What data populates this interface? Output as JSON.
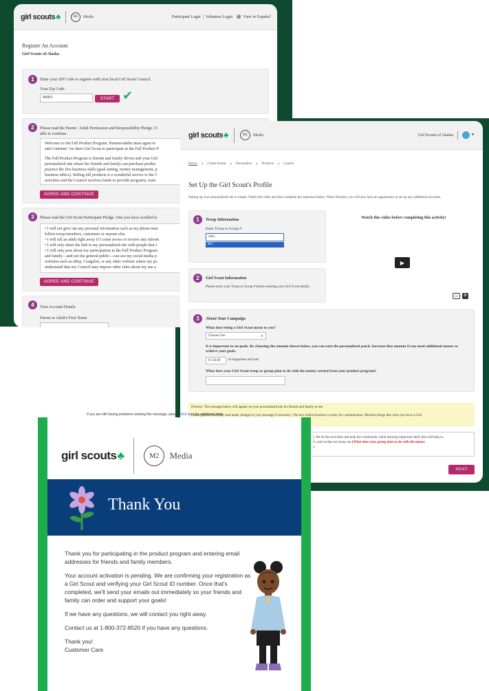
{
  "brand": {
    "gs": "girl scouts",
    "m2": "M2",
    "media": "Media"
  },
  "win1": {
    "nav": {
      "participant": "Participant Login",
      "volunteer": "Volunteer Login",
      "espanol": "View in Español"
    },
    "title": "Register An Account",
    "council": "Girl Scouts of Alaska",
    "step1": {
      "num": "1",
      "text": "Enter your ZIP Code to register with your local Girl Scout Council.",
      "label": "Your Zip Code",
      "value": "00001",
      "button": "START"
    },
    "step2": {
      "num": "2",
      "text": "Please read the Parent / Adult Permission and Responsibility Pledge. O",
      "text2": "able to continue.",
      "box": [
        "Welcome to the Fall Product Program. Parents/adults must agree to",
        "and Continue\" for their Girl Scout to participate in the Fall Product P",
        "",
        "The Fall Product Program is friends and family driven and your Girl",
        "personalized site where her friends and family can purchase produc",
        "practice the five business skills (goal setting, money management, p",
        "business ethics). Selling fall products is a wonderful service to the C",
        "activities and the Council receives funds to provide programs, train"
      ],
      "button": "AGREE AND CONTINUE"
    },
    "step3": {
      "num": "3",
      "text": "Please read the Girl Scout Participant Pledge. One you have scrolled to",
      "box": [
        "• I will not give out any personal information such as my phone num",
        "fellow troop members, customers or anyone else.",
        "• I will tell an adult right away if I come across or receive any inform",
        "• I will only share the link to my personalized site with people that I",
        "• I will only post about my participation in the Fall Product Program",
        "and family—and not the general public—can see my social media p",
        "websites such as eBay, Craigslist, or any other website where my po",
        "understand that my Council may impose other rules about my use a"
      ],
      "button": "AGREE AND CONTINUE"
    },
    "step4": {
      "num": "4",
      "text": "Your Account Details",
      "label": "Parent or Adult's First Name"
    }
  },
  "win2": {
    "org": "Girl Scouts of Alaska",
    "crumbs": [
      "Basics",
      "Create Avatar",
      "Personalize",
      "Products",
      "Launch"
    ],
    "title": "Set Up the Girl Scout's Profile",
    "intro": "Setting up your personalized site is simple. Watch the video and then complete the questions below. When finished, you will also have an opportunity to set up any additional accounts.",
    "troop": {
      "num": "1",
      "title": "Troop Information",
      "label": "Enter Troop or Group #",
      "value": "AK5",
      "option": "867"
    },
    "video": {
      "title": "Watch this video before completing this activity!",
      "cc": "CC"
    },
    "gsinfo": {
      "num": "2",
      "title": "Girl Scout Information",
      "text": "Please select your Troop or Group # before entering your Girl Scout details."
    },
    "campaign": {
      "num": "3",
      "title": "About Your Campaign",
      "q1": "What does being a Girl Scout mean to you?",
      "select": "Choose One",
      "goal": "It is important to set goals. By choosing the amount shown below, you can earn the personalized patch. Increase that amount if you need additional money to achieve your goals.",
      "currency": "$",
      "amount": "150.00",
      "suffix": "in magazines and nuts",
      "q2": "What does your Girl Scout troop or group plan to do with the money earned from your product program?"
    },
    "preview": "Preview: The message below will appear on your personalized site for friends and family to see.",
    "preview2": "Please proceed carefully and make changes to your message if necessary. The text within brackets is ready for customization. Mention things like what you do as a Girl",
    "msg1": "]. We do fun activities and help the community while learning important skills that will help us",
    "msg2": "rs, and so that our troop can ",
    "msg_red": "[What does your group plan to do with the money",
    "msg3": "s.",
    "next": "NEXT"
  },
  "card": {
    "trouble": "If you are still having problems viewing this message, please",
    "trouble_link": "click here",
    "trouble_end": "for additional help.",
    "thank": "Thank You",
    "p1": "Thank you for participating in the product program and entering email addresses for friends and family members.",
    "p2": "Your account activation is pending. We are confirming your registration as a Girl Scout and verifying your Girl Scout ID number. Once that's completed, we'll send your emails out immediately so your friends and family can order and support your goals!",
    "p3": "If we have any questions, we will contact you right away.",
    "p4": "Contact us at 1-800-372-8520 if you have any questions.",
    "p5a": "Thank you!",
    "p5b": "Customer Care"
  },
  "colors": {
    "green": "#1eac4c",
    "darkgreen": "#0d4a2f",
    "purple": "#8c3b8e",
    "pink": "#b52b6a",
    "blue": "#0a3e7a"
  }
}
